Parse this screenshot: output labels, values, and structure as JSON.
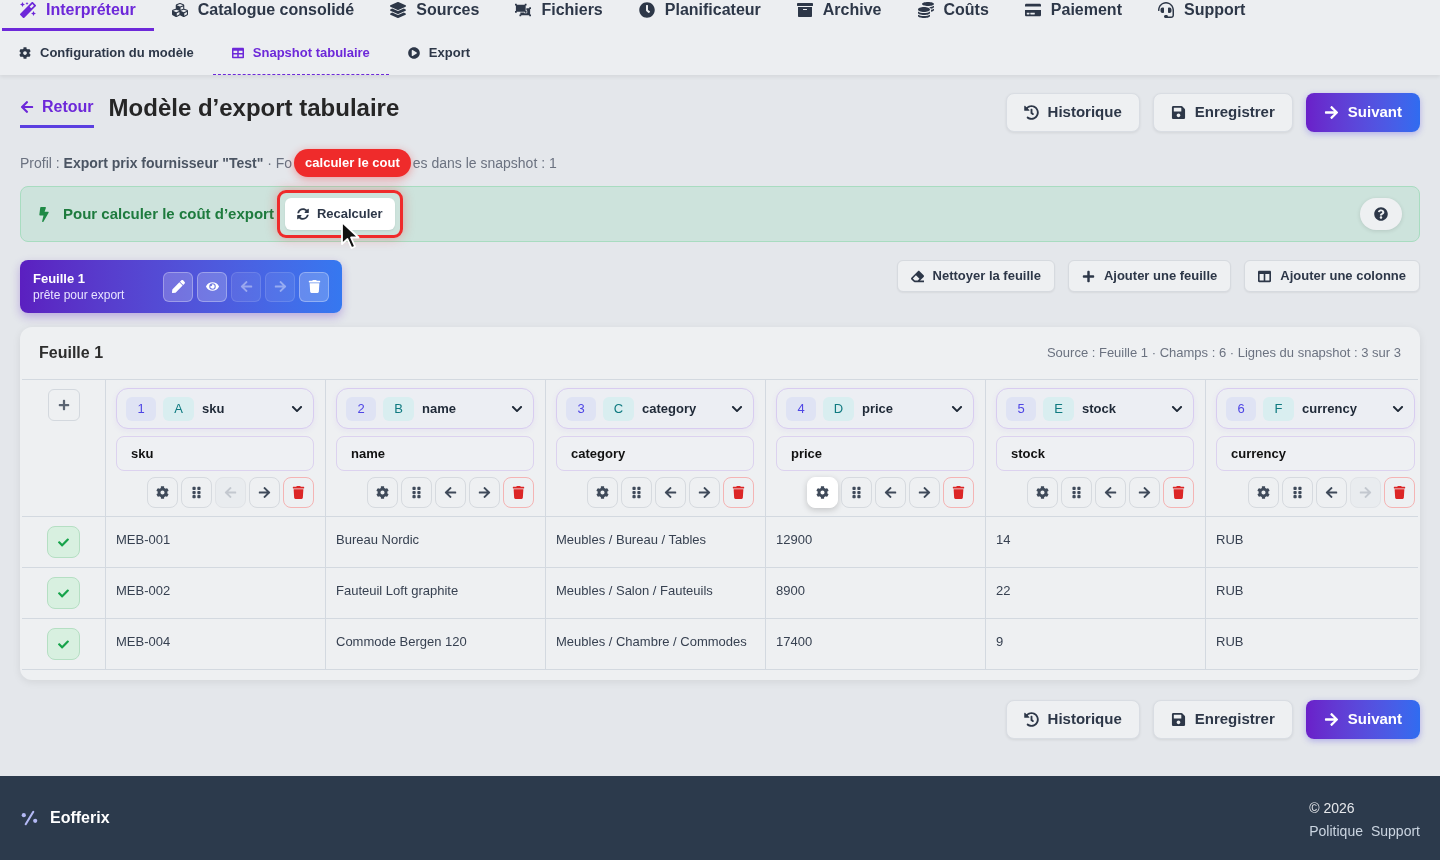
{
  "main_nav": [
    {
      "label": "Interpréteur",
      "selected": true
    },
    {
      "label": "Catalogue consolidé",
      "selected": false
    },
    {
      "label": "Sources",
      "selected": false
    },
    {
      "label": "Fichiers",
      "selected": false
    },
    {
      "label": "Planificateur",
      "selected": false
    },
    {
      "label": "Archive",
      "selected": false
    },
    {
      "label": "Coûts",
      "selected": false
    },
    {
      "label": "Paiement",
      "selected": false
    },
    {
      "label": "Support",
      "selected": false
    }
  ],
  "sub_tabs": [
    {
      "label": "Configuration du modèle",
      "selected": false
    },
    {
      "label": "Snapshot tabulaire",
      "selected": true
    },
    {
      "label": "Export",
      "selected": false
    }
  ],
  "header": {
    "back_link": "Retour",
    "title": "Modèle d’export tabulaire",
    "actions": [
      {
        "kind": "history",
        "label": "Historique"
      },
      {
        "kind": "save",
        "label": "Enregistrer"
      },
      {
        "kind": "next",
        "label": "Suivant"
      }
    ]
  },
  "profile_line": {
    "before": "Profil : **Export prix fournisseur \"Test\"** · Fo",
    "tooltip": "calculer le cout",
    "after": "es dans le snapshot : 1"
  },
  "notice": {
    "text": "Pour calculer le coût d’export",
    "button": "Recalculer",
    "highlighted": true,
    "cursor": true
  },
  "sheet": {
    "name": "Feuille 1",
    "status": "prête pour export",
    "tools": [
      {
        "kind": "edit",
        "disabled": false
      },
      {
        "kind": "view",
        "disabled": false
      },
      {
        "kind": "move_left",
        "disabled": true
      },
      {
        "kind": "move_right",
        "disabled": true
      },
      {
        "kind": "delete",
        "disabled": false
      }
    ]
  },
  "sheet_toolbar": [
    {
      "kind": "clear",
      "label": "Nettoyer la feuille"
    },
    {
      "kind": "add_sheet",
      "label": "Ajouter une feuille"
    },
    {
      "kind": "add_column",
      "label": "Ajouter une colonne"
    }
  ],
  "table": {
    "title": "Feuille 1",
    "summary": "Source : Feuille 1 · Champs : 6 · Lignes du snapshot : 3 sur 3",
    "columns": [
      {
        "number": "1",
        "letter": "A",
        "source": "sku",
        "field": "sku",
        "left_disabled": true,
        "right_disabled": false,
        "settings_hovered": false
      },
      {
        "number": "2",
        "letter": "B",
        "source": "name",
        "field": "name",
        "left_disabled": false,
        "right_disabled": false,
        "settings_hovered": false
      },
      {
        "number": "3",
        "letter": "C",
        "source": "category",
        "field": "category",
        "left_disabled": false,
        "right_disabled": false,
        "settings_hovered": false
      },
      {
        "number": "4",
        "letter": "D",
        "source": "price",
        "field": "price",
        "left_disabled": false,
        "right_disabled": false,
        "settings_hovered": true
      },
      {
        "number": "5",
        "letter": "E",
        "source": "stock",
        "field": "stock",
        "left_disabled": false,
        "right_disabled": false,
        "settings_hovered": false
      },
      {
        "number": "6",
        "letter": "F",
        "source": "currency",
        "field": "currency",
        "left_disabled": false,
        "right_disabled": true,
        "settings_hovered": false
      }
    ],
    "rows": [
      {
        "checked": true,
        "cells": [
          "MEB-001",
          "Bureau Nordic",
          "Meubles / Bureau / Tables",
          "12900",
          "14",
          "RUB"
        ]
      },
      {
        "checked": true,
        "cells": [
          "MEB-002",
          "Fauteuil Loft graphite",
          "Meubles / Salon / Fauteuils",
          "8900",
          "22",
          "RUB"
        ]
      },
      {
        "checked": true,
        "cells": [
          "MEB-004",
          "Commode Bergen 120",
          "Meubles / Chambre / Commodes",
          "17400",
          "9",
          "RUB"
        ]
      }
    ]
  },
  "footer_actions": [
    {
      "kind": "history",
      "label": "Historique"
    },
    {
      "kind": "save",
      "label": "Enregistrer"
    },
    {
      "kind": "next",
      "label": "Suivant"
    }
  ],
  "footer": {
    "brand": "Eofferix",
    "copyright": "© 2026",
    "links": [
      "Politique",
      "Support"
    ]
  }
}
